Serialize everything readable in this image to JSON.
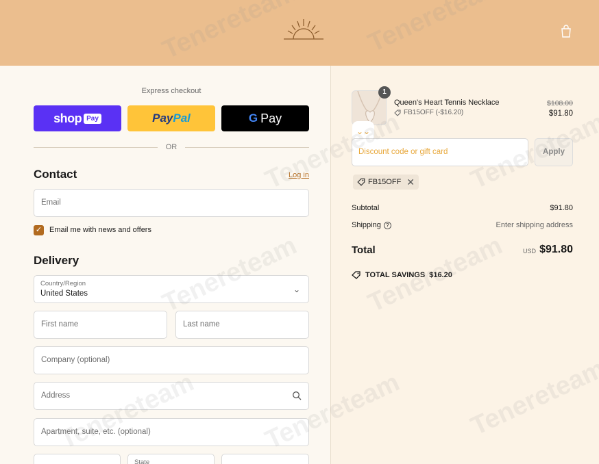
{
  "header": {
    "logo_icon": "sunrise-logo-icon",
    "cart_icon": "shopping-bag-icon",
    "accent_color": "#ebbe8e"
  },
  "express": {
    "label": "Express checkout",
    "shop_pay": {
      "word": "shop",
      "badge": "Pay"
    },
    "paypal": {
      "part1": "Pay",
      "part2": "Pal"
    },
    "gpay": {
      "g": "G",
      "word": "Pay"
    },
    "or_text": "OR"
  },
  "contact": {
    "title": "Contact",
    "login_link": "Log in",
    "email_placeholder": "Email",
    "newsletter_label": "Email me with news and offers",
    "newsletter_checked": true
  },
  "delivery": {
    "title": "Delivery",
    "country_label": "Country/Region",
    "country_value": "United States",
    "first_name_placeholder": "First name",
    "last_name_placeholder": "Last name",
    "company_placeholder": "Company (optional)",
    "address_placeholder": "Address",
    "apartment_placeholder": "Apartment, suite, etc. (optional)",
    "state_label": "State"
  },
  "order": {
    "item": {
      "quantity": "1",
      "name": "Queen's Heart Tennis Necklace",
      "discount_code": "FB15OFF (-$16.20)",
      "original_price": "$108.00",
      "price": "$91.80"
    },
    "discount_placeholder": "Discount code or gift card",
    "apply_label": "Apply",
    "applied_code": "FB15OFF",
    "subtotal_label": "Subtotal",
    "subtotal_value": "$91.80",
    "shipping_label": "Shipping",
    "shipping_value": "Enter shipping address",
    "total_label": "Total",
    "total_currency": "USD",
    "total_value": "$91.80",
    "savings_label": "TOTAL SAVINGS",
    "savings_value": "$16.20"
  },
  "watermark_text": "Tenereteam"
}
